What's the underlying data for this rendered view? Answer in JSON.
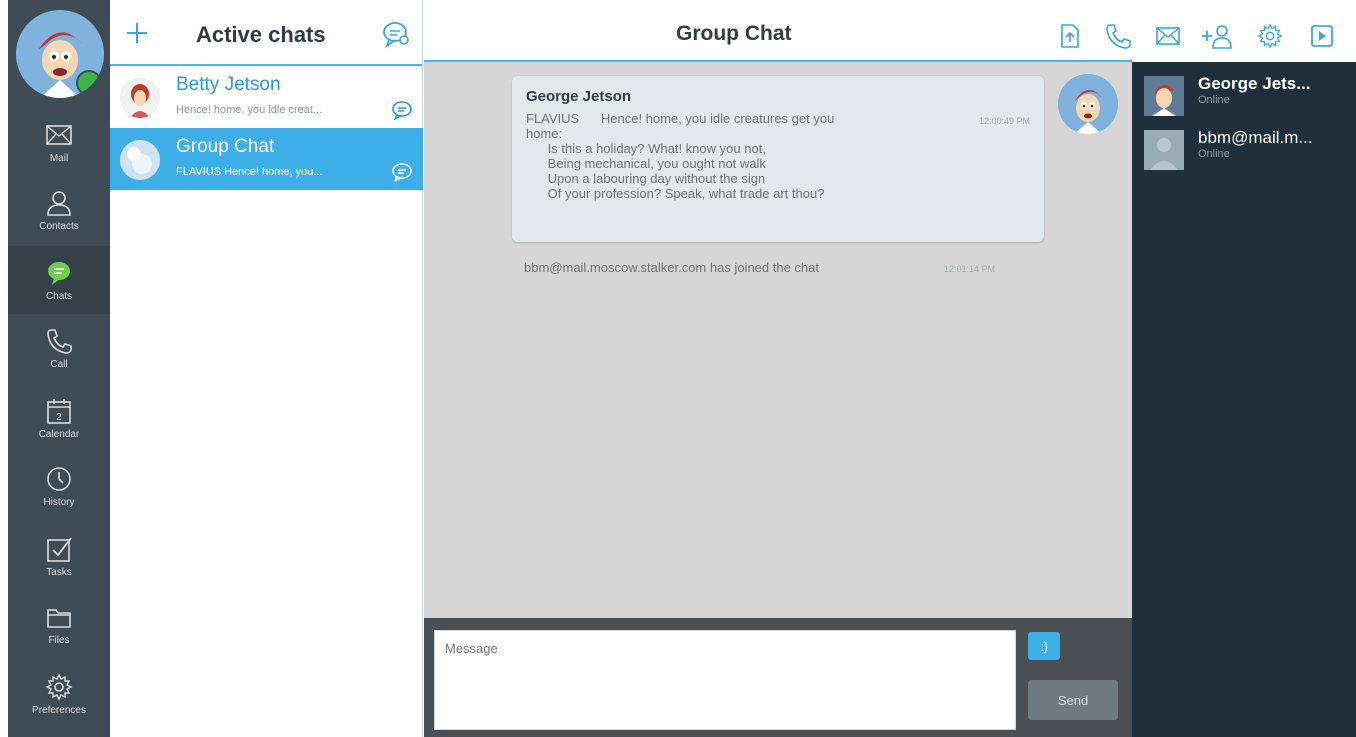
{
  "nav": {
    "items": [
      {
        "label": "Mail",
        "icon": "mail-icon"
      },
      {
        "label": "Contacts",
        "icon": "contacts-icon"
      },
      {
        "label": "Chats",
        "icon": "chats-icon"
      },
      {
        "label": "Call",
        "icon": "phone-icon"
      },
      {
        "label": "Calendar",
        "icon": "calendar-icon",
        "badge": "2"
      },
      {
        "label": "History",
        "icon": "clock-icon"
      },
      {
        "label": "Tasks",
        "icon": "checkbox-icon"
      },
      {
        "label": "Files",
        "icon": "folder-icon"
      },
      {
        "label": "Preferences",
        "icon": "gear-icon"
      }
    ]
  },
  "chats": {
    "title": "Active chats",
    "items": [
      {
        "name": "Betty Jetson",
        "preview": "Hence! home, you idle creat..."
      },
      {
        "name": "Group Chat",
        "preview": "FLAVIUS Hence! home, you..."
      }
    ]
  },
  "main": {
    "title": "Group Chat",
    "message": {
      "sender": "George Jetson",
      "text": "FLAVIUS      Hence! home, you idle creatures get you\nhome:\n      Is this a holiday? What! know you not,\n      Being mechanical, you ought not walk\n      Upon a labouring day without the sign\n      Of your profession? Speak, what trade art thou?",
      "time": "12:00:49 PM"
    },
    "system": {
      "text": "bbm@mail.moscow.stalker.com has joined the chat",
      "time": "12:01:14 PM"
    },
    "composer": {
      "placeholder": "Message",
      "emoji_label": ":)",
      "send_label": "Send"
    }
  },
  "participants": [
    {
      "name": "George Jets...",
      "status": "Online"
    },
    {
      "name": "bbm@mail.m...",
      "status": "Online"
    }
  ],
  "colors": {
    "accent": "#3daee8",
    "nav_bg": "#3f4b55",
    "participants_bg": "#1f2f3b"
  }
}
